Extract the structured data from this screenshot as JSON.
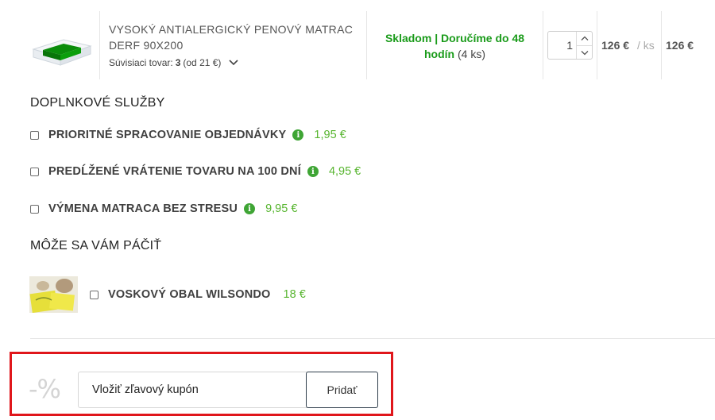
{
  "cart_item": {
    "name": "VYSOKÝ ANTIALERGICKÝ PENOVÝ MATRAC DERF 90X200",
    "related_label": "Súvisiaci tovar:",
    "related_count": "3",
    "related_price": "(od 21 €)",
    "stock_status": "Skladom | Doručíme do 48 hodín",
    "stock_count": "(4 ks)",
    "quantity": "1",
    "unit_price": "126 €",
    "unit_suffix": "/ ks",
    "total_price": "126 €"
  },
  "services": {
    "heading": "DOPLNKOVÉ SLUŽBY",
    "items": [
      {
        "label": "PRIORITNÉ SPRACOVANIE OBJEDNÁVKY",
        "price": "1,95 €",
        "checked": false
      },
      {
        "label": "PREDĹŽENÉ VRÁTENIE TOVARU NA 100 DNÍ",
        "price": "4,95 €",
        "checked": false
      },
      {
        "label": "VÝMENA MATRACA BEZ STRESU",
        "price": "9,95 €",
        "checked": false
      }
    ]
  },
  "recommendations": {
    "heading": "MÔŽE SA VÁM PÁČIŤ",
    "items": [
      {
        "label": "VOSKOVÝ OBAL WILSONDO",
        "price": "18 €",
        "checked": false
      }
    ]
  },
  "coupon": {
    "percent_symbol": "-%",
    "placeholder": "Vložiť zľavový kupón",
    "button_label": "Pridať"
  },
  "colors": {
    "stock_green": "#1a9b1a",
    "price_green": "#57b52f",
    "info_green": "#3fa535",
    "highlight_red": "#e0161b",
    "button_border": "#2f3e4c"
  },
  "icons": {
    "info": "info-icon",
    "chevron": "chevron-down-icon",
    "qty_up": "chevron-up-icon",
    "qty_down": "chevron-down-icon"
  }
}
